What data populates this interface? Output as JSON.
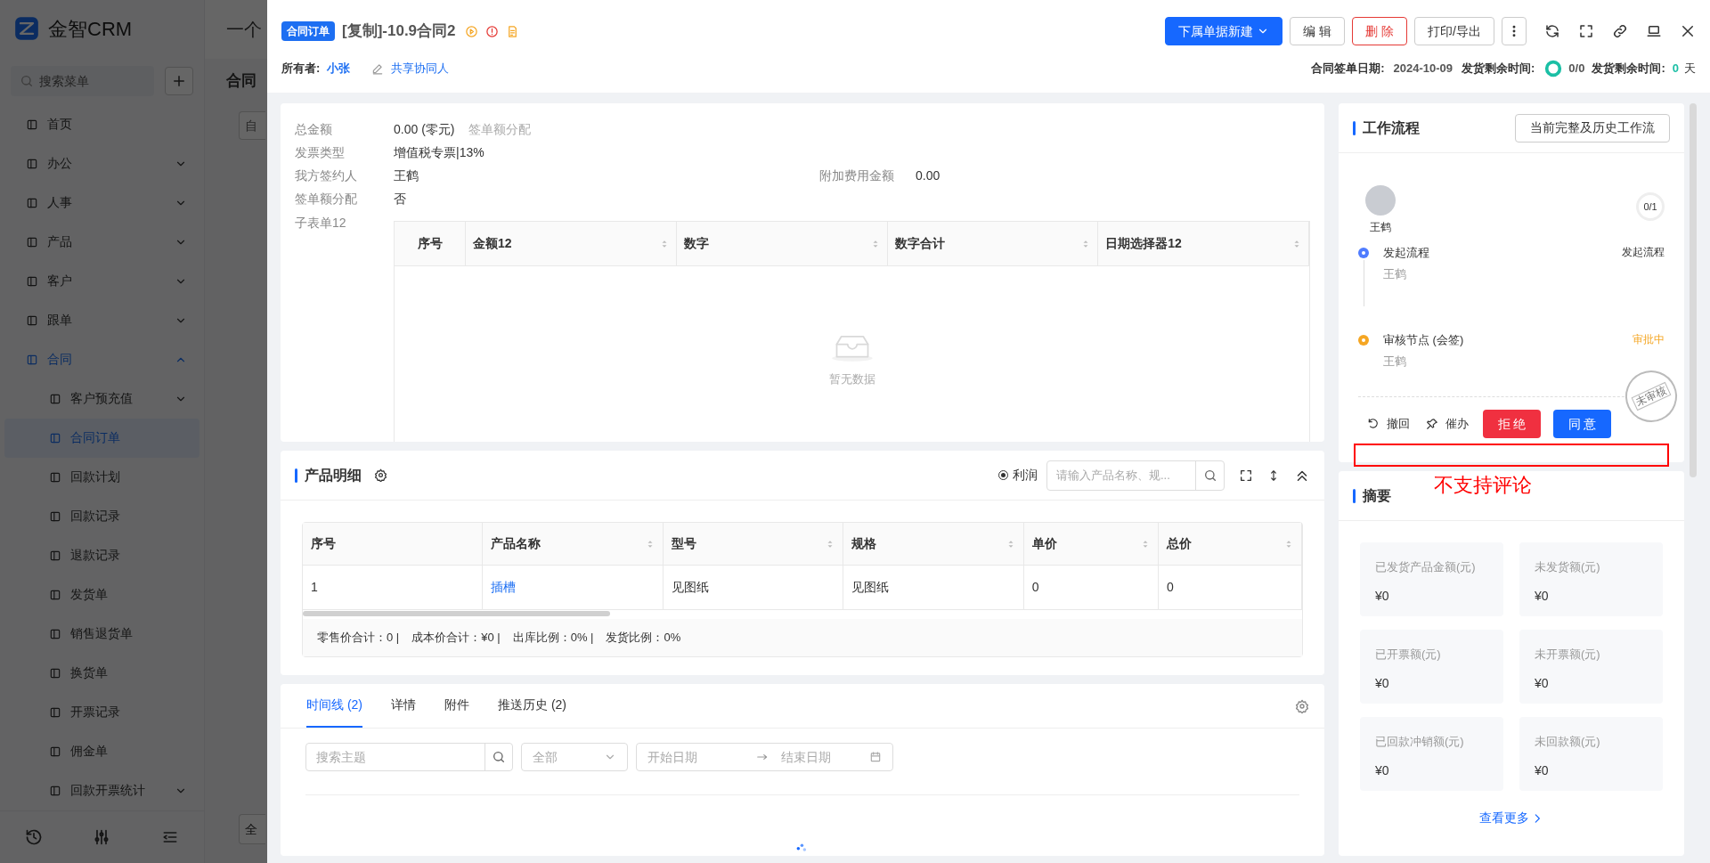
{
  "background": {
    "logo": "金智CRM",
    "search_placeholder": "搜索菜单",
    "page_title": "一个",
    "tab_title": "合同",
    "filter_text": "自",
    "footer_text": "全",
    "menu": [
      {
        "label": "首页",
        "kind": "link",
        "selected": false
      },
      {
        "label": "办公",
        "kind": "group",
        "expanded": false
      },
      {
        "label": "人事",
        "kind": "group",
        "expanded": false
      },
      {
        "label": "产品",
        "kind": "group",
        "expanded": false
      },
      {
        "label": "客户",
        "kind": "group",
        "expanded": false
      },
      {
        "label": "跟单",
        "kind": "group",
        "expanded": false
      },
      {
        "label": "合同",
        "kind": "group",
        "expanded": true,
        "children": [
          {
            "label": "客户预充值",
            "kind": "group",
            "expanded": false
          },
          {
            "label": "合同订单",
            "kind": "link",
            "selected": true
          },
          {
            "label": "回款计划",
            "kind": "link",
            "selected": false
          },
          {
            "label": "回款记录",
            "kind": "link",
            "selected": false
          },
          {
            "label": "退款记录",
            "kind": "link",
            "selected": false
          },
          {
            "label": "发货单",
            "kind": "link",
            "selected": false
          },
          {
            "label": "销售退货单",
            "kind": "link",
            "selected": false
          },
          {
            "label": "换货单",
            "kind": "link",
            "selected": false
          },
          {
            "label": "开票记录",
            "kind": "link",
            "selected": false
          },
          {
            "label": "佣金单",
            "kind": "link",
            "selected": false
          },
          {
            "label": "回款开票统计",
            "kind": "group",
            "expanded": false
          }
        ]
      }
    ]
  },
  "header": {
    "badge": "合同订单",
    "title": "[复制]-10.9合同2",
    "buttons": [
      {
        "label": "下属单据新建",
        "kind": "primary"
      },
      {
        "label": "编 辑",
        "kind": "default"
      },
      {
        "label": "删 除",
        "kind": "danger"
      },
      {
        "label": "打印/导出",
        "kind": "default"
      }
    ],
    "owner_label": "所有者:",
    "owner": "小张",
    "share_link": "共享协同人",
    "date_label": "合同签单日期:",
    "date": "2024-10-09",
    "remain_label": "发货剩余时间:",
    "remain_ratio": "0/0",
    "remain_label_2": "发货剩余时间:",
    "remain_days": "0",
    "remain_unit": "天"
  },
  "details": {
    "fields": [
      {
        "label": "总金额",
        "value": "0.00 (零元)",
        "hint": "签单额分配"
      },
      {
        "label": "发票类型",
        "value": "增值税专票|13%"
      },
      {
        "label": "我方签约人",
        "value": "王鹤",
        "extra_label": "附加费用金额",
        "extra_value": "0.00"
      },
      {
        "label": "签单额分配",
        "value": "否"
      }
    ],
    "subtable": {
      "label": "子表单12",
      "columns": [
        {
          "label": "序号",
          "sortable": false
        },
        {
          "label": "金额12",
          "sortable": true
        },
        {
          "label": "数字",
          "sortable": true
        },
        {
          "label": "数字合计",
          "sortable": true
        },
        {
          "label": "日期选择器12",
          "sortable": true
        }
      ],
      "empty_text": "暂无数据"
    }
  },
  "products": {
    "title": "产品明细",
    "profit_toggle": {
      "label": "利润",
      "checked": true
    },
    "search_placeholder": "请输入产品名称、规...",
    "columns": [
      {
        "label": "序号",
        "sortable": false
      },
      {
        "label": "产品名称",
        "sortable": true
      },
      {
        "label": "型号",
        "sortable": true
      },
      {
        "label": "规格",
        "sortable": true
      },
      {
        "label": "单价",
        "sortable": true
      },
      {
        "label": "总价",
        "sortable": true
      }
    ],
    "rows": [
      [
        "1",
        "插槽",
        "见图纸",
        "见图纸",
        "0",
        "0"
      ]
    ],
    "totals": [
      "零售价合计：0 |",
      "成本价合计：¥0 |",
      "出库比例：0% |",
      "发货比例：0%"
    ]
  },
  "activity": {
    "tabs": [
      {
        "label": "时间线 (2)",
        "selected": true
      },
      {
        "label": "详情",
        "selected": false
      },
      {
        "label": "附件",
        "selected": false
      },
      {
        "label": "推送历史 (2)",
        "selected": false
      }
    ],
    "search_placeholder": "搜索主题",
    "type_select": "全部",
    "start_placeholder": "开始日期",
    "end_placeholder": "结束日期"
  },
  "workflow": {
    "title": "工作流程",
    "history_button": "当前完整及历史工作流",
    "user": "王鹤",
    "progress": "0/1",
    "steps": [
      {
        "kind": "start",
        "title": "发起流程",
        "person": "王鹤",
        "status": "发起流程"
      },
      {
        "kind": "review",
        "title": "审核节点 (会签)",
        "person": "王鹤",
        "status": "审批中"
      }
    ],
    "stamp": "未审核",
    "actions": [
      {
        "label": "撤回",
        "kind": "undo"
      },
      {
        "label": "催办",
        "kind": "pin"
      },
      {
        "label": "拒 绝",
        "kind": "reject"
      },
      {
        "label": "同 意",
        "kind": "approve"
      }
    ],
    "annotation": "不支持评论"
  },
  "summary": {
    "title": "摘要",
    "items": [
      {
        "label": "已发货产品金额(元)",
        "value": "¥0"
      },
      {
        "label": "未发货额(元)",
        "value": "¥0"
      },
      {
        "label": "已开票额(元)",
        "value": "¥0"
      },
      {
        "label": "未开票额(元)",
        "value": "¥0"
      },
      {
        "label": "已回款冲销额(元)",
        "value": "¥0"
      },
      {
        "label": "未回款额(元)",
        "value": "¥0"
      }
    ],
    "more": "查看更多"
  }
}
